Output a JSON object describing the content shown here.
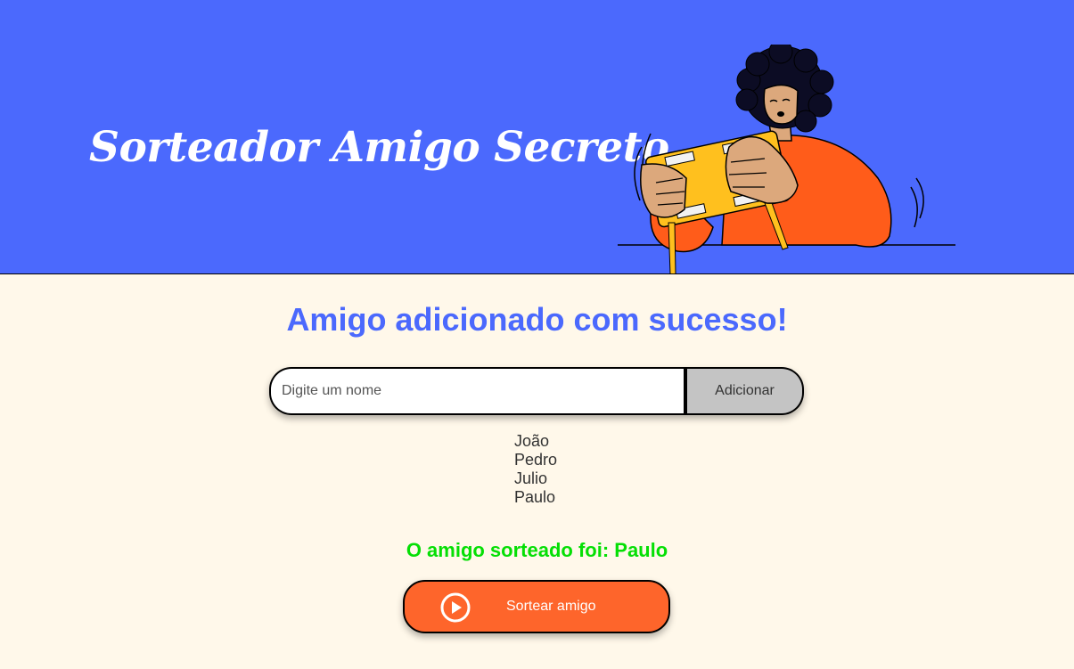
{
  "header": {
    "title": "Sorteador Amigo Secreto",
    "illustration": "person-opening-gift-box",
    "background_color": "#4B69FD"
  },
  "main": {
    "message": "Amigo adicionado com sucesso!",
    "input": {
      "placeholder": "Digite um nome",
      "value": ""
    },
    "add_button_label": "Adicionar",
    "friends": [
      "João",
      "Pedro",
      "Julio",
      "Paulo"
    ],
    "result": "O amigo sorteado foi: Paulo",
    "draw_button": {
      "label": "Sortear amigo",
      "icon": "play-circle-icon",
      "color": "#FE652B"
    },
    "background_color": "#FFF8EA",
    "message_color": "#4B69FD",
    "result_color": "#05DF05"
  }
}
